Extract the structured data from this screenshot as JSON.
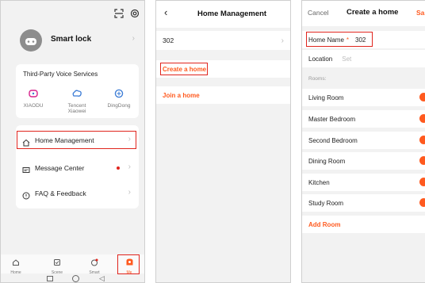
{
  "panel1": {
    "device_name": "Smart lock",
    "voice_section_title": "Third-Party Voice Services",
    "voice_services": [
      {
        "label": "XIAODU"
      },
      {
        "label": "Tencent\nXiaowei"
      },
      {
        "label": "DingDong"
      }
    ],
    "menu": {
      "home_management": "Home Management",
      "message_center": "Message Center",
      "faq_feedback": "FAQ & Feedback"
    },
    "tabs": {
      "home": "Home",
      "scene": "Scene",
      "smart": "Smart",
      "me": "Me"
    },
    "colors": {
      "accent": "#ff5a1f",
      "highlight": "#e0241d",
      "link_blue": "#3a7bd5"
    }
  },
  "panel2": {
    "title": "Home Management",
    "home_item": "302",
    "create_home": "Create a home",
    "join_home": "Join a home"
  },
  "panel3": {
    "cancel": "Cancel",
    "title": "Create a home",
    "save": "Sa",
    "home_name_label": "Home Name",
    "required_mark": "*",
    "home_name_value": "302",
    "location_label": "Location",
    "location_placeholder": "Set",
    "rooms_header": "Rooms:",
    "rooms": [
      "Living Room",
      "Master Bedroom",
      "Second Bedroom",
      "Dining Room",
      "Kitchen",
      "Study Room"
    ],
    "add_room": "Add Room"
  }
}
